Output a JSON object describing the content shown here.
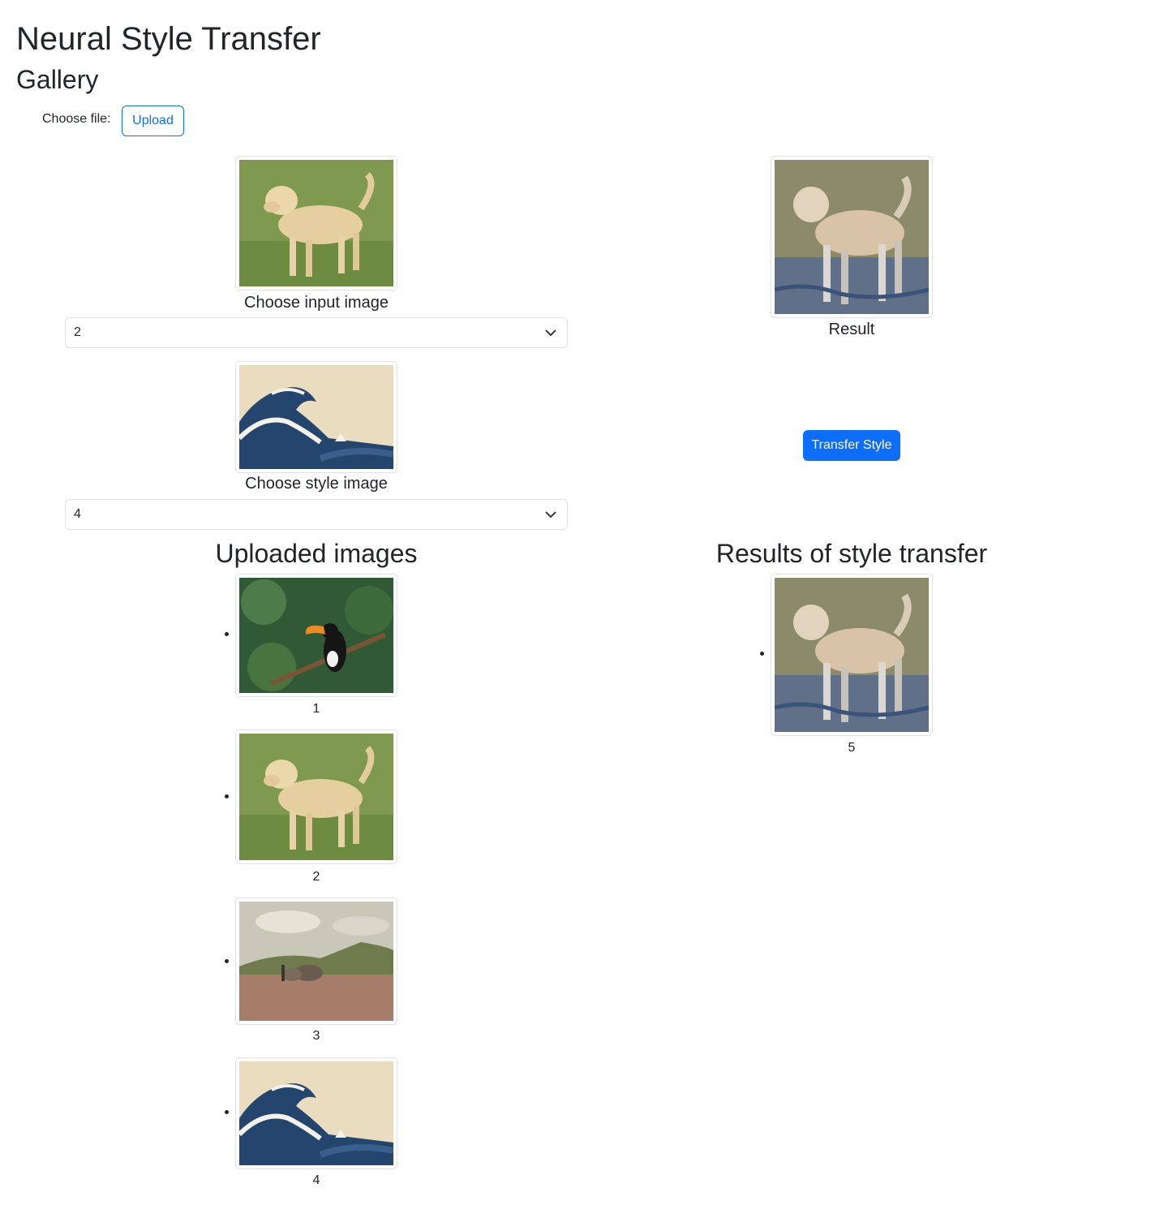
{
  "header": {
    "title": "Neural Style Transfer",
    "subtitle": "Gallery"
  },
  "upload": {
    "label": "Choose file:",
    "button_label": "Upload"
  },
  "input": {
    "caption": "Choose input image",
    "selected": "2",
    "image": "labrador-dog"
  },
  "style": {
    "caption": "Choose style image",
    "selected": "4",
    "image": "great-wave"
  },
  "result": {
    "caption": "Result",
    "image": "stylized-dog",
    "button_label": "Transfer Style"
  },
  "uploaded": {
    "title": "Uploaded images",
    "items": [
      {
        "label": "1",
        "image": "toucan"
      },
      {
        "label": "2",
        "image": "labrador-dog"
      },
      {
        "label": "3",
        "image": "oxen-landscape-painting"
      },
      {
        "label": "4",
        "image": "great-wave"
      }
    ]
  },
  "results": {
    "title": "Results of style transfer",
    "items": [
      {
        "label": "5",
        "image": "stylized-dog"
      }
    ]
  },
  "colors": {
    "primary": "#0d6efd",
    "text": "#212529",
    "border": "#dee2e6"
  }
}
